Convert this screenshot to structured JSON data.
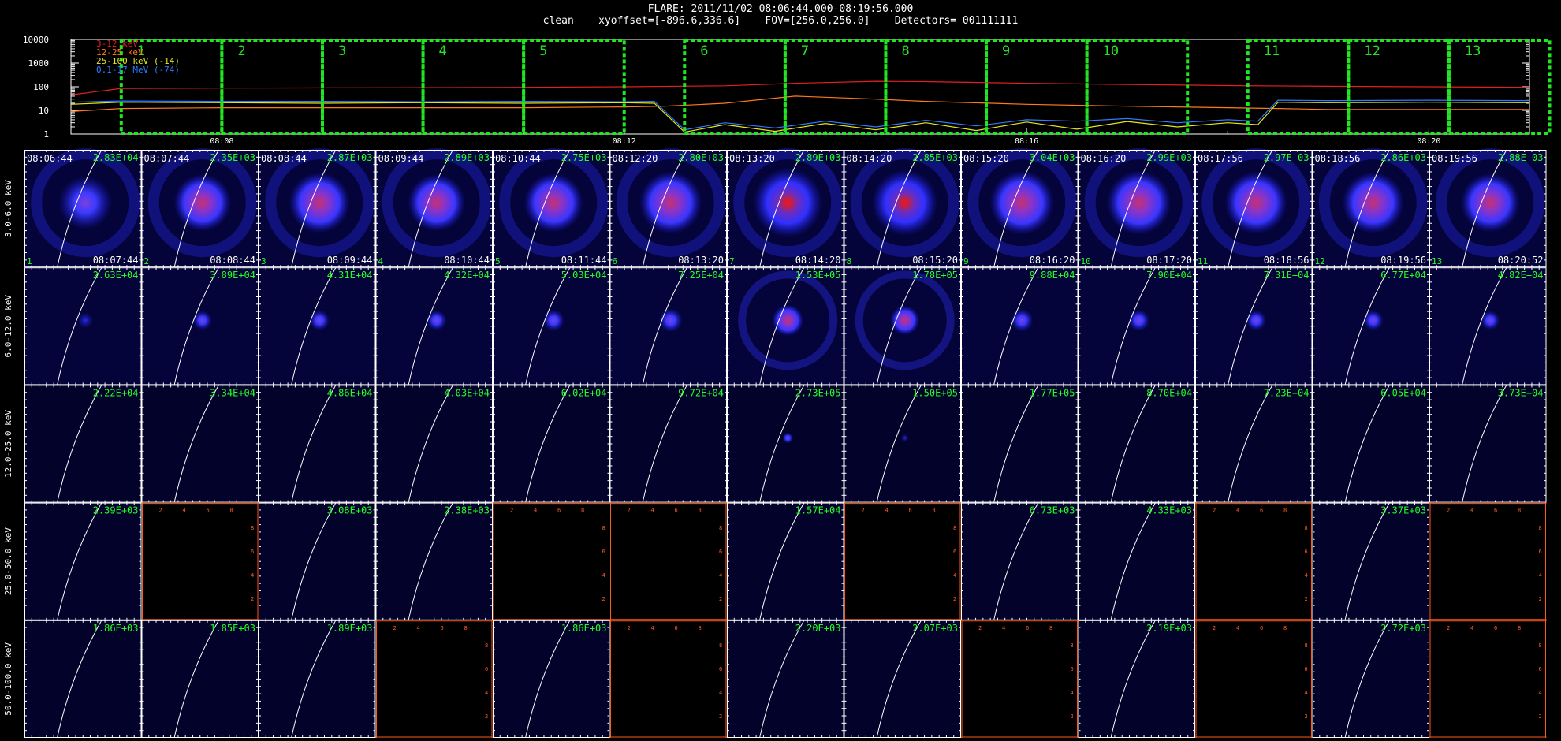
{
  "header": {
    "line1": "FLARE: 2011/11/02 08:06:44.000-08:19:56.000",
    "line2": "clean    xyoffset=[-896.6,336.6]    FOV=[256.0,256.0]    Detectors= 001111111"
  },
  "colors": {
    "background": "#000000",
    "box": "#22e622",
    "label_green": "#22ff22",
    "band_red": "#e02020",
    "band_orange": "#ff7a1a",
    "band_yellow": "#e6e61e",
    "band_blue": "#2f7bff",
    "empty_axes": "#ff5a1e"
  },
  "chart_data": [
    {
      "type": "line",
      "yscale": "log",
      "ylim": [
        1,
        10000
      ],
      "yticks": [
        "10000",
        "1000",
        "100",
        "10",
        "1"
      ],
      "xtick_labels": [
        "08:08",
        "08:12",
        "08:16",
        "08:20"
      ],
      "xlim_min": [
        2.5,
        17.0
      ],
      "xticks_min": [
        4.0,
        8.0,
        12.0,
        16.0
      ],
      "series": [
        {
          "name": "3-12 keV",
          "color": "#e02020",
          "x": [
            2.5,
            3.0,
            4.0,
            5.0,
            6.0,
            7.0,
            8.0,
            9.0,
            9.7,
            10.5,
            11.0,
            12.0,
            13.0,
            14.0,
            15.0,
            16.0,
            17.0
          ],
          "y": [
            45,
            85,
            88,
            90,
            92,
            95,
            100,
            110,
            140,
            170,
            165,
            140,
            125,
            112,
            105,
            100,
            95
          ]
        },
        {
          "name": "12-25 keV",
          "color": "#ff7a1a",
          "x": [
            2.5,
            3.0,
            4.0,
            5.0,
            6.0,
            7.0,
            8.0,
            8.4,
            9.0,
            9.7,
            10.5,
            11.0,
            12.0,
            13.0,
            14.0,
            14.5,
            15.0,
            16.0,
            17.0
          ],
          "y": [
            9,
            12,
            13,
            13,
            13,
            13,
            14,
            15,
            20,
            40,
            30,
            24,
            18,
            15,
            13,
            12,
            11,
            11,
            11
          ]
        },
        {
          "name": "25-100 keV (-14)",
          "color": "#e6e61e",
          "x": [
            2.5,
            3.0,
            4.0,
            5.0,
            6.0,
            7.0,
            8.0,
            8.3,
            8.6,
            9.0,
            9.5,
            10.0,
            10.5,
            11.0,
            11.5,
            12.0,
            12.5,
            13.0,
            13.5,
            14.0,
            14.3,
            14.5,
            15.0,
            16.0,
            17.0
          ],
          "y": [
            18,
            22,
            21,
            20,
            21,
            20,
            21,
            20,
            1.2,
            2.5,
            1.3,
            2.8,
            1.5,
            3.0,
            1.4,
            3.2,
            1.6,
            3.4,
            2.0,
            3.0,
            2.5,
            22,
            21,
            22,
            21
          ]
        },
        {
          "name": "0.1-17 MeV (-74)",
          "color": "#2f7bff",
          "x": [
            2.5,
            3.0,
            4.0,
            5.0,
            6.0,
            7.0,
            8.0,
            8.3,
            8.6,
            9.0,
            9.5,
            10.0,
            10.5,
            11.0,
            11.5,
            12.0,
            12.5,
            13.0,
            13.5,
            14.0,
            14.3,
            14.5,
            15.0,
            16.0,
            17.0
          ],
          "y": [
            22,
            25,
            24,
            24,
            23,
            24,
            23,
            24,
            1.5,
            3.0,
            1.8,
            3.5,
            2.0,
            3.8,
            2.2,
            4.0,
            3.5,
            4.5,
            3.0,
            4.0,
            3.5,
            27,
            26,
            27,
            26
          ]
        }
      ],
      "intervals": [
        {
          "label": "1",
          "x0": 3.0,
          "x1": 4.0
        },
        {
          "label": "2",
          "x0": 4.0,
          "x1": 5.0
        },
        {
          "label": "3",
          "x0": 5.0,
          "x1": 6.0
        },
        {
          "label": "4",
          "x0": 6.0,
          "x1": 7.0
        },
        {
          "label": "5",
          "x0": 7.0,
          "x1": 8.0
        },
        {
          "label": "6",
          "x0": 8.6,
          "x1": 9.6
        },
        {
          "label": "7",
          "x0": 9.6,
          "x1": 10.6
        },
        {
          "label": "8",
          "x0": 10.6,
          "x1": 11.6
        },
        {
          "label": "9",
          "x0": 11.6,
          "x1": 12.6
        },
        {
          "label": "10",
          "x0": 12.6,
          "x1": 13.6
        },
        {
          "label": "11",
          "x0": 14.2,
          "x1": 15.2
        },
        {
          "label": "12",
          "x0": 15.2,
          "x1": 16.2
        },
        {
          "label": "13",
          "x0": 16.2,
          "x1": 17.2
        }
      ]
    },
    {
      "type": "heatmap",
      "image_grid": true,
      "rows": [
        "3.0-6.0 keV",
        "6.0-12.0 keV",
        "12.0-25.0 keV",
        "25.0-50.0 keV",
        "50.0-100.0 keV"
      ],
      "columns": [
        {
          "n": "1",
          "start": "08:06:44",
          "end": "08:07:44"
        },
        {
          "n": "2",
          "start": "08:07:44",
          "end": "08:08:44"
        },
        {
          "n": "3",
          "start": "08:08:44",
          "end": "08:09:44"
        },
        {
          "n": "4",
          "start": "08:09:44",
          "end": "08:10:44"
        },
        {
          "n": "5",
          "start": "08:10:44",
          "end": "08:11:44"
        },
        {
          "n": "6",
          "start": "08:12:20",
          "end": "08:13:20"
        },
        {
          "n": "7",
          "start": "08:13:20",
          "end": "08:14:20"
        },
        {
          "n": "8",
          "start": "08:14:20",
          "end": "08:15:20"
        },
        {
          "n": "9",
          "start": "08:15:20",
          "end": "08:16:20"
        },
        {
          "n": "10",
          "start": "08:16:20",
          "end": "08:17:20"
        },
        {
          "n": "11",
          "start": "08:17:56",
          "end": "08:18:56"
        },
        {
          "n": "12",
          "start": "08:18:56",
          "end": "08:19:56"
        },
        {
          "n": "13",
          "start": "08:19:56",
          "end": "08:20:52"
        }
      ],
      "max_values": [
        [
          "2.83E+04",
          "2.35E+03",
          "2.87E+03",
          "2.89E+03",
          "2.75E+03",
          "2.80E+03",
          "2.89E+03",
          "2.85E+03",
          "3.04E+03",
          "2.99E+03",
          "2.97E+03",
          "2.86E+03",
          "2.88E+03"
        ],
        [
          "2.63E+04",
          "3.89E+04",
          "4.31E+04",
          "4.32E+04",
          "5.03E+04",
          "7.25E+04",
          "1.53E+05",
          "1.78E+05",
          "9.88E+04",
          "7.90E+04",
          "7.31E+04",
          "6.77E+04",
          "4.82E+04"
        ],
        [
          "2.22E+04",
          "3.34E+04",
          "4.86E+04",
          "4.03E+04",
          "6.02E+04",
          "9.72E+04",
          "2.73E+05",
          "1.50E+05",
          "1.77E+05",
          "8.70E+04",
          "7.23E+04",
          "6.05E+04",
          "3.73E+04"
        ],
        [
          "2.39E+03",
          null,
          "3.08E+03",
          "2.38E+03",
          null,
          null,
          "1.57E+04",
          null,
          "6.73E+03",
          "4.33E+03",
          null,
          "3.37E+03",
          null
        ],
        [
          "1.86E+03",
          "1.85E+03",
          "1.89E+03",
          null,
          "1.86E+03",
          null,
          "2.20E+03",
          "2.07E+03",
          null,
          "2.19E+03",
          null,
          "2.72E+03",
          null
        ]
      ],
      "source_strength": [
        [
          0.55,
          0.65,
          0.75,
          0.65,
          0.7,
          0.8,
          1.0,
          0.9,
          0.85,
          0.85,
          0.8,
          0.78,
          0.7
        ],
        [
          0.15,
          0.3,
          0.35,
          0.35,
          0.4,
          0.5,
          0.85,
          0.75,
          0.45,
          0.4,
          0.35,
          0.35,
          0.3
        ],
        [
          0.0,
          0.0,
          0.0,
          0.0,
          0.0,
          0.0,
          0.3,
          0.1,
          0.0,
          0.0,
          0.0,
          0.0,
          0.0
        ],
        [
          0,
          0,
          0,
          0,
          0,
          0,
          0,
          0,
          0,
          0,
          0,
          0,
          0
        ],
        [
          0,
          0,
          0,
          0,
          0,
          0,
          0,
          0,
          0,
          0,
          0,
          0,
          0
        ]
      ],
      "empty_axis_ticks": [
        "2",
        "4",
        "6",
        "8"
      ]
    }
  ]
}
